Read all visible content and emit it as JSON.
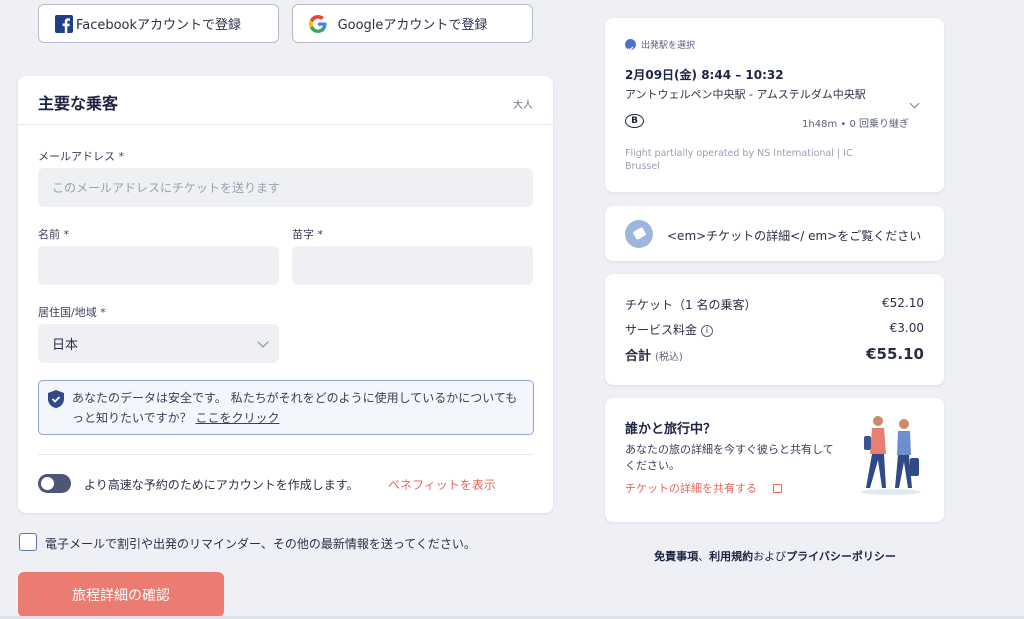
{
  "social": {
    "facebook_label": "Facebookアカウントで登録",
    "google_label": "Googleアカウントで登録"
  },
  "passenger_form": {
    "title": "主要な乗客",
    "badge": "大人",
    "email_label": "メールアドレス *",
    "email_placeholder": "このメールアドレスにチケットを送ります",
    "first_name_label": "名前 *",
    "last_name_label": "苗字 *",
    "country_label": "居住国/地域 *",
    "country_value": "日本",
    "secure_text": "あなたのデータは安全です。 私たちがそれをどのように使用しているかについてもっと知りたいですか？",
    "secure_link": "ここをクリック",
    "account_toggle_text": "より高速な予約のためにアカウントを作成します。",
    "benefit_link": "ベネフィットを表示"
  },
  "newsletter_text": "電子メールで割引や出発のリマインダー、その他の最新情報を送ってください。",
  "confirm_button": "旅程詳細の確認",
  "trip": {
    "step_label": "出発駅を選択",
    "date_time": "2月09日(金)   8:44 – 10:32",
    "route": "アントウェルペン中央駅  -  アムステルダム中央駅",
    "operator_logo": "B",
    "duration": "1h48m • 0 回乗り継ぎ",
    "operated_by": "Flight partially operated by NS International | IC Brussel"
  },
  "ticket_details_text": "<em>チケットの詳細</ em>をご覧ください",
  "pricing": {
    "ticket_label": "チケット（1 名の乗客）",
    "ticket_value": "€52.10",
    "service_label": "サービス料金",
    "service_value": "€3.00",
    "total_label": "合計",
    "total_sub": "(税込)",
    "total_value": "€55.10"
  },
  "share": {
    "title": "誰かと旅行中？",
    "description": "あなたの旅の詳細を今すぐ彼らと共有してください。",
    "link": "チケットの詳細を共有する"
  },
  "footer": {
    "disclaimer": "免責事項",
    "terms": "利用規約",
    "and": "および",
    "privacy": "プライバシーポリシー",
    "separator": "、"
  },
  "colors": {
    "accent": "#ec7b72",
    "link": "#e36a5f",
    "brand_blue": "#4a72c7"
  }
}
